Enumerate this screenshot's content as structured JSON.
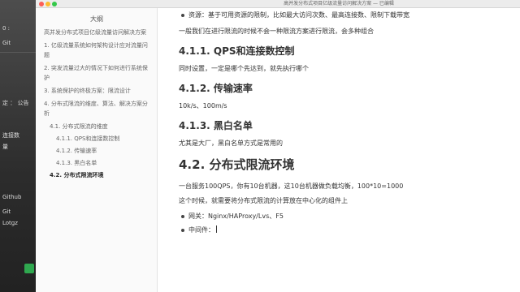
{
  "desktop": {
    "items": [
      "0 :",
      "Git",
      "定 ：  公告",
      "连接数",
      "量"
    ],
    "lower_items": [
      "Github",
      "Git",
      "Lotgz"
    ]
  },
  "window": {
    "title": "高并发分布式项目亿级流量访问解决方案 — 已编辑"
  },
  "sidebar": {
    "title": "大纲",
    "items": [
      {
        "level": 1,
        "label": "高并发分布式项目亿级流量访问解决方案"
      },
      {
        "level": 1,
        "label": "1. 亿级流量系统如何架构设计应对流量问题"
      },
      {
        "level": 1,
        "label": "2. 突发流量过大的情况下如何进行系统保护"
      },
      {
        "level": 1,
        "label": "3. 系统保护的终极方案：限流设计"
      },
      {
        "level": 1,
        "label": "4. 分布式限流的维度、算法、解决方案分析"
      },
      {
        "level": 2,
        "label": "4.1. 分布式限流的维度"
      },
      {
        "level": 3,
        "label": "4.1.1. QPS和连接数控制"
      },
      {
        "level": 3,
        "label": "4.1.2. 传输速率"
      },
      {
        "level": 3,
        "label": "4.1.3. 黑白名单"
      },
      {
        "level": 2,
        "label": "4.2. 分布式限流环境",
        "active": true
      }
    ]
  },
  "doc": {
    "resource_bullet": "资源：基于可用资源的限制，比如最大访问次数、最高连接数、限制下载带宽",
    "intro": "一般我们在进行限流的时候不会一种限流方案进行限流，会多种组合",
    "h411": "4.1.1. QPS和连接数控制",
    "p411": "同时设置，一定是哪个先达到，就先执行哪个",
    "h412": "4.1.2. 传输速率",
    "p412": "10k/s、100m/s",
    "h413": "4.1.3. 黑白名单",
    "p413": "尤其是大厂，黑白名单方式是常用的",
    "h42": "4.2. 分布式限流环境",
    "p42a": "一台服务100QPS，你有10台机器，这10台机器做负载均衡，100*10=1000",
    "p42b": "这个时候，就需要将分布式限流的计算放在中心化的组件上",
    "bullet1": "网关：Nginx/HAProxy/Lvs、F5",
    "bullet2": "中间件："
  },
  "colors": {
    "close": "#fc5f57",
    "minimize": "#fdbc2e",
    "zoom": "#34c84a"
  }
}
